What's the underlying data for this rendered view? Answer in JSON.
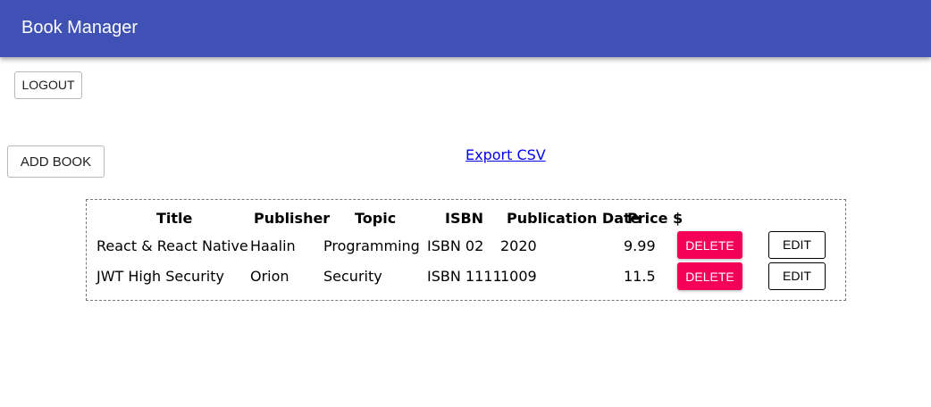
{
  "app": {
    "title": "Book Manager",
    "brand_color": "#3f51b5"
  },
  "actions": {
    "logout_label": "LOGOUT",
    "add_book_label": "ADD BOOK",
    "export_label": "Export CSV"
  },
  "table": {
    "headers": [
      "Title",
      "Publisher",
      "Topic",
      "ISBN",
      "Publication Date",
      "Price $"
    ],
    "rows": [
      {
        "title": "React & React Native",
        "publisher": "Haalin",
        "topic": "Programming",
        "isbn": "ISBN 02",
        "publication_date": "2020",
        "price": "9.99",
        "delete_label": "DELETE",
        "edit_label": "EDIT"
      },
      {
        "title": "JWT High Security",
        "publisher": "Orion",
        "topic": "Security",
        "isbn": "ISBN 1111",
        "publication_date": "1009",
        "price": "11.5",
        "delete_label": "DELETE",
        "edit_label": "EDIT"
      }
    ],
    "delete_color": "#f50057"
  }
}
